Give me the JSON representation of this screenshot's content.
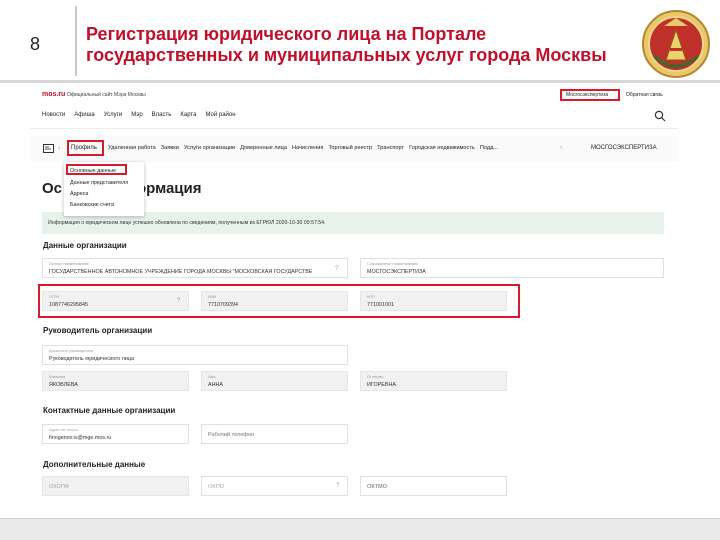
{
  "slide": {
    "number": "8",
    "title": "Регистрация юридического лица на Портале государственных и муниципальных услуг города Москвы",
    "accent_color": "#c0102a"
  },
  "site": {
    "logo": "mos.ru",
    "logo_sub": "Официальный сайт Мэра Москвы",
    "mosexp_link": "Мосгосэкспертиза",
    "feedback": "Обратная связь",
    "nav": [
      "Новости",
      "Афиша",
      "Услуги",
      "Мэр",
      "Власть",
      "Карта",
      "Мой район"
    ]
  },
  "profilebar": {
    "profile": "Профиль",
    "tabs": [
      "Удаленная работа",
      "Заявки",
      "Услуги организации",
      "Доверенные лица",
      "Начисления",
      "Торговый реестр",
      "Транспорт",
      "Городская недвижимость",
      "Подд..."
    ],
    "org_name": "МОСГОСЭКСПЕРТИЗА"
  },
  "dropdown": {
    "items": [
      "Основные данные",
      "Данные представителя",
      "Адреса",
      "Банковские счета"
    ]
  },
  "main": {
    "heading_visible": "Ос",
    "heading_tail": "формация",
    "info": "Информация о юридическом лице успешно обновлена по сведениям, полученным из ЕГРЮЛ 2020-10-30 09:57:54.",
    "sections": {
      "org": "Данные организации",
      "head": "Руководитель организации",
      "contacts": "Контактные данные организации",
      "extra": "Дополнительные данные"
    },
    "fields": {
      "full_name_label": "Полное наименование",
      "full_name": "ГОСУДАРСТВЕННОЕ АВТОНОМНОЕ УЧРЕЖДЕНИЕ ГОРОДА МОСКВЫ \"МОСКОВСКАЯ ГОСУДАРСТВЕ",
      "short_name_label": "Сокращенное наименование",
      "short_name": "МОСГОСЭКСПЕРТИЗА",
      "ogrn_label": "ОГРН",
      "ogrn": "1087746295845",
      "inn_label": "ИНН",
      "inn": "7710709394",
      "kpp_label": "КПП",
      "kpp": "771001001",
      "position_label": "Должность руководителя",
      "position": "Руководитель юридического лица",
      "lastname_label": "Фамилия",
      "lastname": "ЯКОВЛЕВА",
      "firstname_label": "Имя",
      "firstname": "АННА",
      "middlename_label": "Отчество",
      "middlename": "ИГОРЕВНА",
      "email_label": "Адрес эл. почты",
      "email": "finogenov.iv@mge.mos.ru",
      "phone_placeholder": "Рабочий телефон",
      "okopf_placeholder": "ОКОПФ",
      "okpo_placeholder": "ОКПО",
      "oktmo_placeholder": "ОКТМО",
      "help": "?"
    }
  }
}
